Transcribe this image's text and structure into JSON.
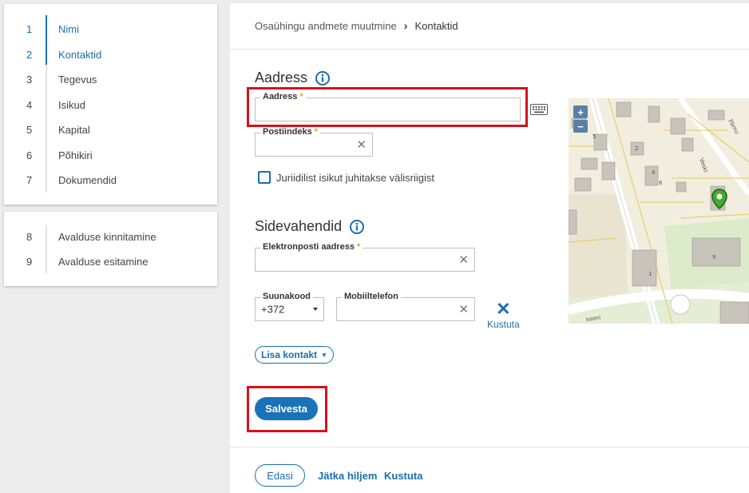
{
  "sidebar": {
    "steps": [
      {
        "num": "1",
        "label": "Nimi"
      },
      {
        "num": "2",
        "label": "Kontaktid"
      },
      {
        "num": "3",
        "label": "Tegevus"
      },
      {
        "num": "4",
        "label": "Isikud"
      },
      {
        "num": "5",
        "label": "Kapital"
      },
      {
        "num": "6",
        "label": "Põhikiri"
      },
      {
        "num": "7",
        "label": "Dokumendid"
      }
    ],
    "final_steps": [
      {
        "num": "8",
        "label": "Avalduse kinnitamine"
      },
      {
        "num": "9",
        "label": "Avalduse esitamine"
      }
    ]
  },
  "breadcrumb": {
    "parent": "Osaühingu andmete muutmine",
    "current": "Kontaktid"
  },
  "address_section": {
    "title": "Aadress",
    "address_label": "Aadress",
    "address_value": "",
    "postal_label": "Postiindeks",
    "postal_value": "",
    "foreign_checkbox_label": "Juriidilist isikut juhitakse välisriigist",
    "foreign_checked": false
  },
  "contact_section": {
    "title": "Sidevahendid",
    "email_label": "Elektronposti aadress",
    "email_value": "",
    "country_code_label": "Suunakood",
    "country_code_value": "+372",
    "mobile_label": "Mobiiltelefon",
    "mobile_value": "",
    "delete_label": "Kustuta",
    "add_contact_label": "Lisa kontakt"
  },
  "map": {
    "zoom_in": "+",
    "zoom_out": "−",
    "labels": [
      "Veski",
      "Pärnu",
      "sooni"
    ],
    "house_numbers": [
      "5",
      "2",
      "4",
      "6",
      "1",
      "9"
    ]
  },
  "actions": {
    "save_label": "Salvesta",
    "next_label": "Edasi",
    "later_label": "Jätka hiljem",
    "delete_label": "Kustuta"
  },
  "colors": {
    "accent": "#1a73b8",
    "required": "#e8a21c",
    "highlight": "#d7111c"
  }
}
